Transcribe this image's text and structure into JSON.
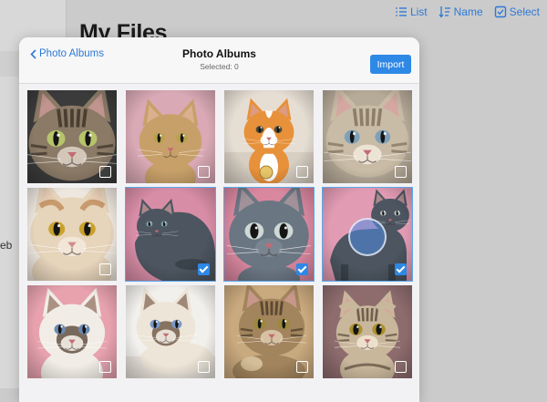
{
  "background": {
    "title": "My Files",
    "sidebar_text": "eb",
    "toolbar": [
      {
        "label": "List",
        "icon": "list-icon"
      },
      {
        "label": "Name",
        "icon": "sort-icon"
      },
      {
        "label": "Select",
        "icon": "checkbox-icon"
      }
    ]
  },
  "modal": {
    "back_label": "Photo Albums",
    "title": "Photo Albums",
    "subtitle": "Selected: 0",
    "import_label": "Import"
  },
  "photos": [
    {
      "kind": "tabby-closeup",
      "bg": "#3b3b3b",
      "fur": "#8a7a66",
      "stripe": "#3a2f26",
      "eye": "#b7c46a",
      "selected": false
    },
    {
      "kind": "abyssinian",
      "bg": "#d9a9b5",
      "fur": "#c7a069",
      "stripe": "#8a6a3e",
      "eye": "#b9a24a",
      "selected": false
    },
    {
      "kind": "ginger-kitten",
      "bg": "#e6ded3",
      "fur": "#e7913a",
      "stripe": "#ffffff",
      "eye": "#4a4a3a",
      "selected": false
    },
    {
      "kind": "siberian",
      "bg": "#b6aa98",
      "fur": "#c9bca6",
      "stripe": "#7d6e5a",
      "eye": "#7fa0b9",
      "selected": false
    },
    {
      "kind": "persian",
      "bg": "#ede7df",
      "fur": "#e6d4bb",
      "stripe": "#b3743a",
      "eye": "#caa22a",
      "selected": false
    },
    {
      "kind": "grey-lying",
      "bg": "#d88da6",
      "fur": "#4c5560",
      "stripe": "#3a424b",
      "eye": "#7ea0a8",
      "selected": true
    },
    {
      "kind": "grey-face",
      "bg": "#d9879f",
      "fur": "#6b7683",
      "stripe": "#525c67",
      "eye": "#cfd9d6",
      "selected": true
    },
    {
      "kind": "grey-standing",
      "bg": "#e19bb3",
      "fur": "#4c5560",
      "stripe": "#39414a",
      "eye": "#b7c0bd",
      "selected": true
    },
    {
      "kind": "ragdoll",
      "bg": "#e7a2ae",
      "fur": "#f1ede6",
      "stripe": "#5b4739",
      "eye": "#6b8ab2",
      "selected": false
    },
    {
      "kind": "himalayan",
      "bg": "#f2f0ec",
      "fur": "#ede5d8",
      "stripe": "#6d5543",
      "eye": "#7a9ac8",
      "selected": false
    },
    {
      "kind": "tabby-paw",
      "bg": "#c9a97e",
      "fur": "#a2845d",
      "stripe": "#4b3a28",
      "eye": "#9c8a3a",
      "selected": false
    },
    {
      "kind": "scottish-fold",
      "bg": "#8e6c6e",
      "fur": "#c9b79c",
      "stripe": "#5a4a3a",
      "eye": "#a9912e",
      "selected": false
    }
  ],
  "colors": {
    "accent": "#2e88e6",
    "selection_outline": "#5aa9ee"
  }
}
